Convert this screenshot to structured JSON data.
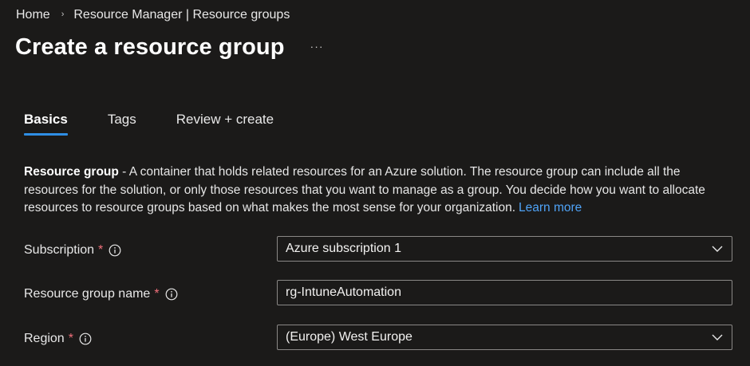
{
  "breadcrumb": {
    "home": "Home",
    "separator": "›",
    "current": "Resource Manager | Resource groups"
  },
  "header": {
    "title": "Create a resource group",
    "more_label": "···"
  },
  "tabs": [
    {
      "label": "Basics",
      "active": true
    },
    {
      "label": "Tags",
      "active": false
    },
    {
      "label": "Review + create",
      "active": false
    }
  ],
  "description": {
    "term": "Resource group",
    "text": " - A container that holds related resources for an Azure solution. The resource group can include all the resources for the solution, or only those resources that you want to manage as a group. You decide how you want to allocate resources to resource groups based on what makes the most sense for your organization.",
    "link": "Learn more"
  },
  "form": {
    "required_marker": "*",
    "subscription": {
      "label": "Subscription",
      "value": "Azure subscription 1",
      "icon": "info-icon"
    },
    "resource_group_name": {
      "label": "Resource group name",
      "value": "rg-IntuneAutomation",
      "icon": "info-icon"
    },
    "region": {
      "label": "Region",
      "value": "(Europe) West Europe",
      "icon": "info-icon"
    }
  },
  "colors": {
    "background": "#1b1a19",
    "accent": "#2f8ee5",
    "link": "#4fa3f7",
    "required": "#f1707b",
    "border": "#8a8886"
  }
}
